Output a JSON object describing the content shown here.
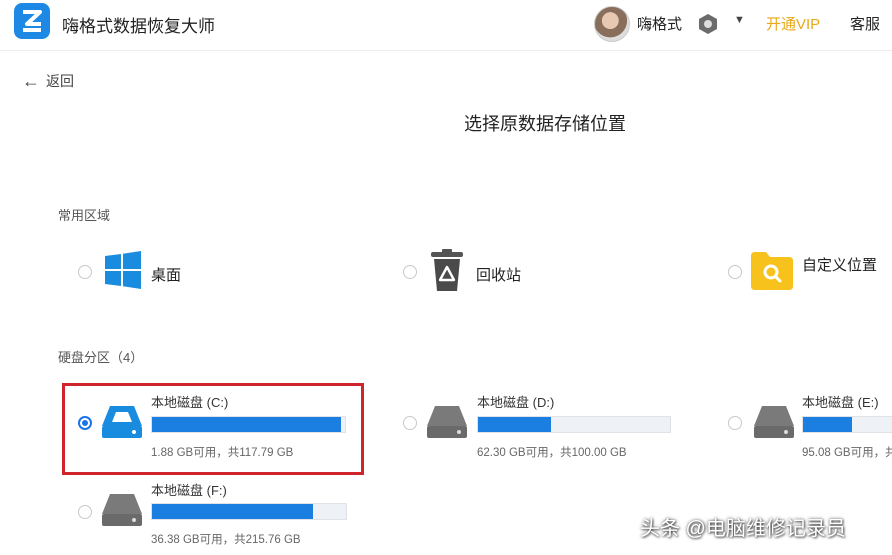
{
  "header": {
    "app_title": "嗨格式数据恢复大师",
    "username": "嗨格式",
    "vip_label": "开通VIP",
    "service_label": "客服"
  },
  "nav": {
    "back_label": "返回"
  },
  "main": {
    "title": "选择原数据存储位置",
    "common_section_label": "常用区域",
    "common_locations": [
      {
        "label": "桌面",
        "icon": "windows-icon"
      },
      {
        "label": "回收站",
        "icon": "recycle-bin-icon"
      },
      {
        "label": "自定义位置",
        "icon": "folder-search-icon"
      }
    ],
    "drives_section_label": "硬盘分区（4）",
    "drives": [
      {
        "name": "本地磁盘 (C:)",
        "info": "1.88 GB可用，共117.79 GB",
        "used_fraction": 0.98,
        "selected": true
      },
      {
        "name": "本地磁盘 (D:)",
        "info": "62.30 GB可用，共100.00 GB",
        "used_fraction": 0.38,
        "selected": false
      },
      {
        "name": "本地磁盘 (E:)",
        "info": "95.08 GB可用，共",
        "used_fraction": 0.55,
        "selected": false
      },
      {
        "name": "本地磁盘 (F:)",
        "info": "36.38 GB可用，共215.76 GB",
        "used_fraction": 0.83,
        "selected": false
      }
    ]
  },
  "watermark": "头条 @电脑维修记录员",
  "colors": {
    "accent": "#1a7fe0",
    "vip": "#e9a91a",
    "highlight": "#d0242b"
  }
}
